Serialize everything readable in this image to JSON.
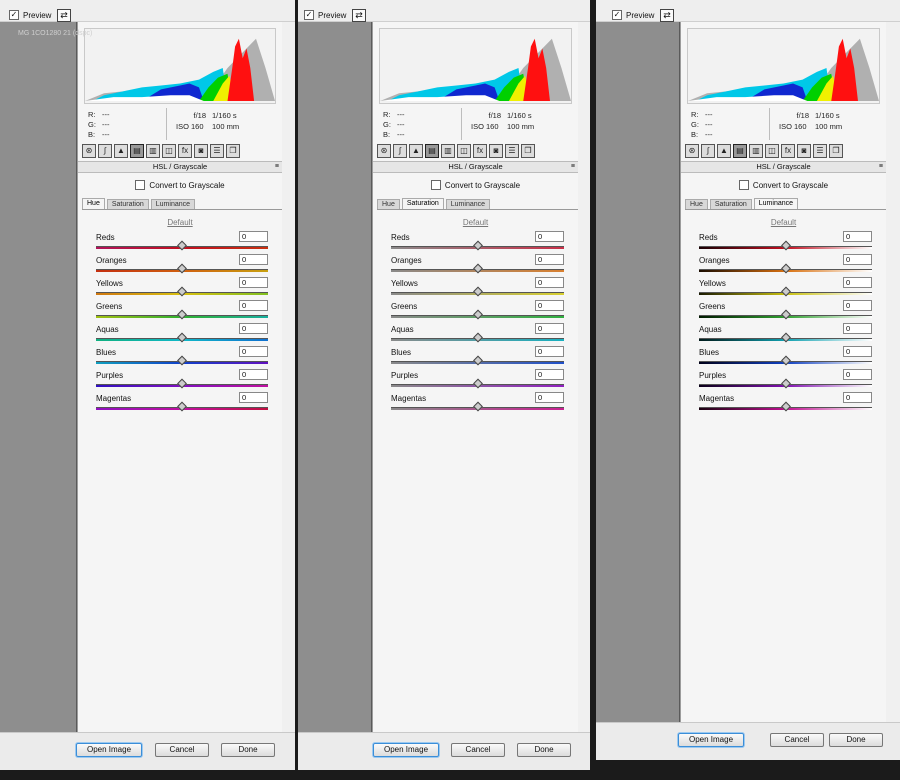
{
  "preview_label": "Preview",
  "section_title": "HSL / Grayscale",
  "convert_label": "Convert to Grayscale",
  "default_label": "Default",
  "exif": {
    "r_label": "R:",
    "g_label": "G:",
    "b_label": "B:",
    "r_value": "---",
    "g_value": "---",
    "b_value": "---",
    "aperture": "f/18",
    "shutter": "1/160 s",
    "iso": "ISO 160",
    "focal": "100 mm"
  },
  "tabs": [
    {
      "label": "Hue"
    },
    {
      "label": "Saturation"
    },
    {
      "label": "Luminance"
    }
  ],
  "sliders": [
    {
      "label": "Reds",
      "value": "0",
      "gradient": {
        "hue": [
          "#b0145a",
          "#c01020",
          "#c83010"
        ],
        "saturation": [
          "#8a8a8a",
          "#c83048"
        ],
        "luminance": [
          "#1a0004",
          "#c01020",
          "#ffffff"
        ]
      }
    },
    {
      "label": "Oranges",
      "value": "0",
      "gradient": {
        "hue": [
          "#c43010",
          "#d06010",
          "#c8a010"
        ],
        "saturation": [
          "#8a8a8a",
          "#d88030"
        ],
        "luminance": [
          "#1a0c00",
          "#d87010",
          "#ffffff"
        ]
      }
    },
    {
      "label": "Yellows",
      "value": "0",
      "gradient": {
        "hue": [
          "#d07810",
          "#d8c010",
          "#80c020"
        ],
        "saturation": [
          "#8a8a8a",
          "#d8d030"
        ],
        "luminance": [
          "#1a1a00",
          "#c8c010",
          "#ffffff"
        ]
      }
    },
    {
      "label": "Greens",
      "value": "0",
      "gradient": {
        "hue": [
          "#a0c010",
          "#30b030",
          "#18b0a0"
        ],
        "saturation": [
          "#8a8a8a",
          "#30b040"
        ],
        "luminance": [
          "#001a00",
          "#30a030",
          "#ffffff"
        ]
      }
    },
    {
      "label": "Aquas",
      "value": "0",
      "gradient": {
        "hue": [
          "#10b080",
          "#10b8c8",
          "#1070d0"
        ],
        "saturation": [
          "#8a8a8a",
          "#18b0c0"
        ],
        "luminance": [
          "#001a1a",
          "#10a0b0",
          "#ffffff"
        ]
      }
    },
    {
      "label": "Blues",
      "value": "0",
      "gradient": {
        "hue": [
          "#10a0c0",
          "#1040c8",
          "#6010c0"
        ],
        "saturation": [
          "#8a8a8a",
          "#2050c8"
        ],
        "luminance": [
          "#00001a",
          "#1040c0",
          "#ffffff"
        ]
      }
    },
    {
      "label": "Purples",
      "value": "0",
      "gradient": {
        "hue": [
          "#3010c0",
          "#8010c0",
          "#c010a0"
        ],
        "saturation": [
          "#8a8a8a",
          "#9020c0"
        ],
        "luminance": [
          "#0a001a",
          "#8010b0",
          "#ffffff"
        ]
      }
    },
    {
      "label": "Magentas",
      "value": "0",
      "gradient": {
        "hue": [
          "#9010c0",
          "#c010a0",
          "#c01040"
        ],
        "saturation": [
          "#8a8a8a",
          "#c82090"
        ],
        "luminance": [
          "#1a0010",
          "#c01090",
          "#ffffff"
        ]
      }
    }
  ],
  "buttons": {
    "open_image": "Open Image",
    "cancel": "Cancel",
    "done": "Done"
  },
  "status_text": "MG 1CO1280 21 (dspc)",
  "panels": [
    {
      "active_tab": "hue"
    },
    {
      "active_tab": "saturation"
    },
    {
      "active_tab": "luminance"
    }
  ],
  "toolbar_icons": [
    "basic-icon",
    "tone-curve-icon",
    "detail-icon",
    "hsl-icon",
    "split-toning-icon",
    "lens-icon",
    "fx-icon",
    "camera-calibration-icon",
    "presets-icon",
    "snapshots-icon"
  ],
  "colors": {
    "button_focus": "#3b8ed8",
    "gray_area": "#8e8e8e",
    "panel_bg": "#f5f5f5"
  }
}
